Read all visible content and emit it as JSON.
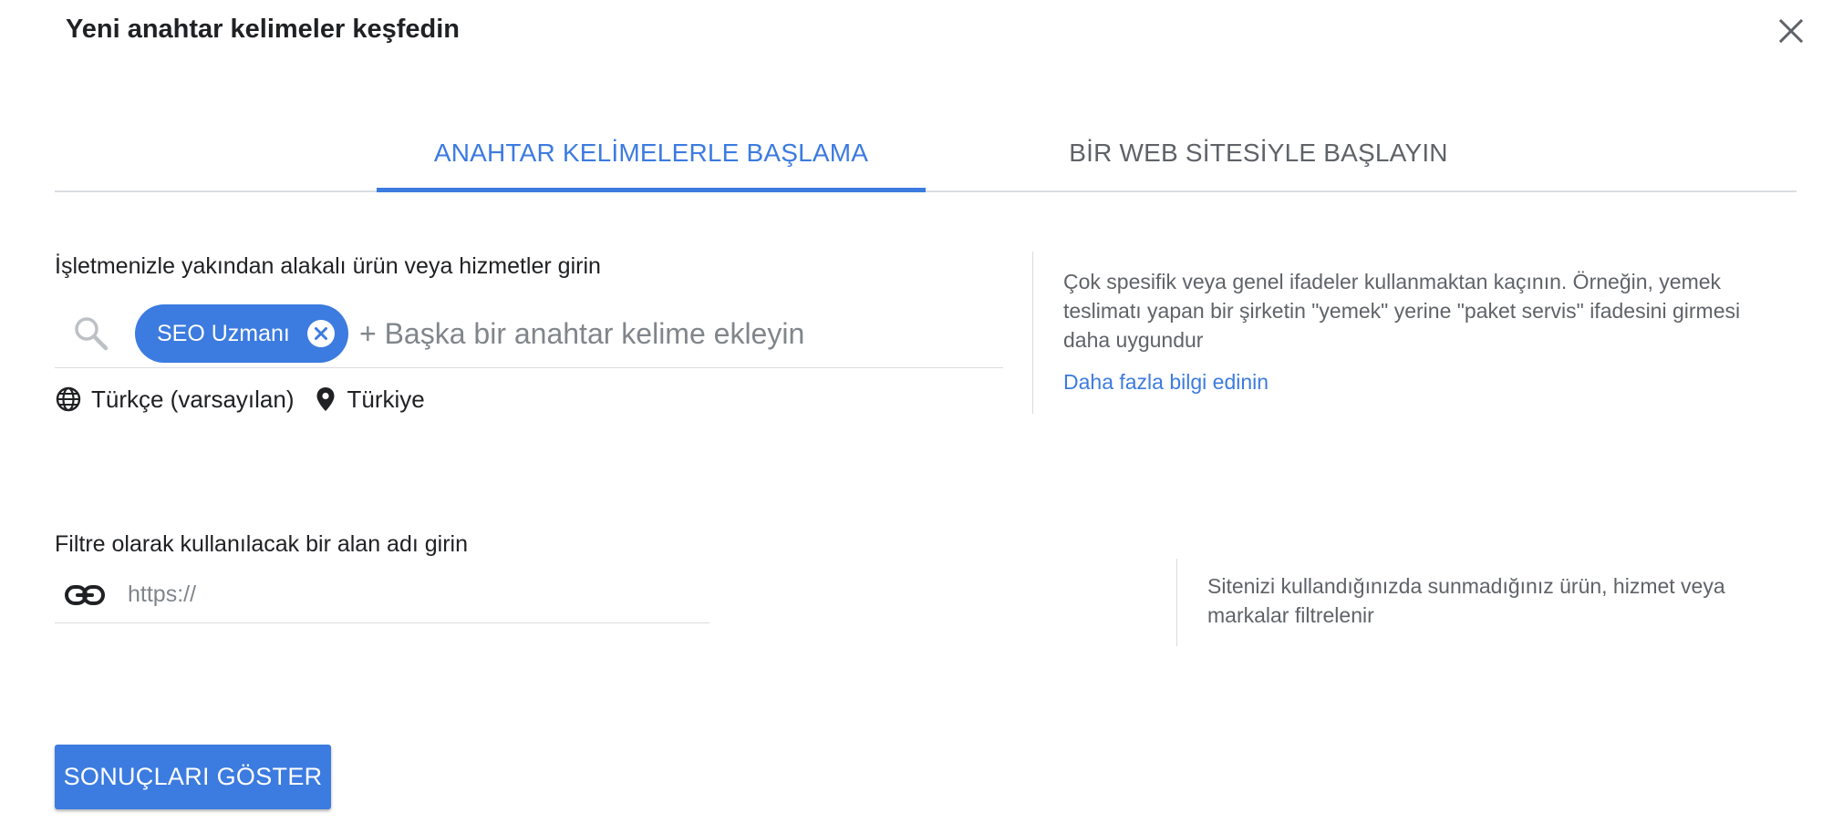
{
  "dialog": {
    "title": "Yeni anahtar kelimeler keşfedin",
    "close_icon": "close-icon"
  },
  "tabs": [
    {
      "label": "ANAHTAR KELİMELERLE BAŞLAMA",
      "active": true
    },
    {
      "label": "BİR WEB SİTESİYLE BAŞLAYIN",
      "active": false
    }
  ],
  "keywords_section": {
    "label": "İşletmenizle yakından alakalı ürün veya hizmetler girin",
    "search_icon": "search-icon",
    "chips": [
      {
        "label": "SEO Uzmanı",
        "remove_icon": "close-circle-icon"
      }
    ],
    "input_placeholder": "+ Başka bir anahtar kelime ekleyin",
    "input_value": "",
    "language": {
      "icon": "globe-icon",
      "label": "Türkçe (varsayılan)"
    },
    "location": {
      "icon": "location-pin-icon",
      "label": "Türkiye"
    },
    "help_text": "Çok spesifik veya genel ifadeler kullanmaktan kaçının. Örneğin, yemek teslimatı yapan bir şirketin \"yemek\" yerine \"paket servis\" ifadesini girmesi daha uygundur",
    "help_link": "Daha fazla bilgi edinin"
  },
  "domain_section": {
    "label": "Filtre olarak kullanılacak bir alan adı girin",
    "link_icon": "link-icon",
    "input_placeholder": "https://",
    "input_value": "",
    "help_text": "Sitenizi kullandığınızda sunmadığınız ürün, hizmet veya markalar filtrelenir"
  },
  "actions": {
    "primary_label": "SONUÇLARI GÖSTER"
  },
  "colors": {
    "accent": "#3c7be0",
    "text_primary": "#202124",
    "text_secondary": "#5f6368",
    "divider": "#dadce0"
  }
}
